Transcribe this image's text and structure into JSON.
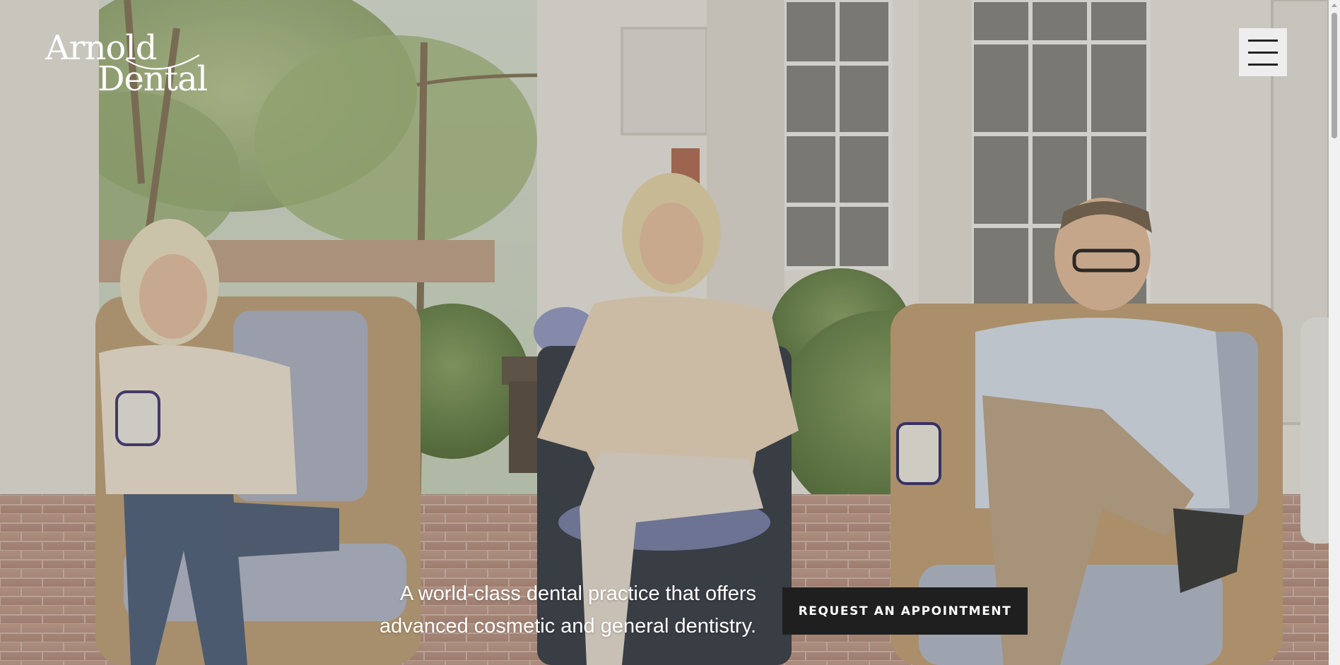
{
  "logo": {
    "line1": "Arnold",
    "line2": "Dental"
  },
  "header": {
    "menu_icon": "hamburger-menu-icon"
  },
  "hero": {
    "tagline_line1": "A world-class dental practice that offers",
    "tagline_line2": "advanced cosmetic and general dentistry.",
    "cta_label": "REQUEST AN APPOINTMENT"
  },
  "colors": {
    "text": "#ffffff",
    "cta_background": "#1f1f1f",
    "menu_background": "#eeeeee"
  }
}
